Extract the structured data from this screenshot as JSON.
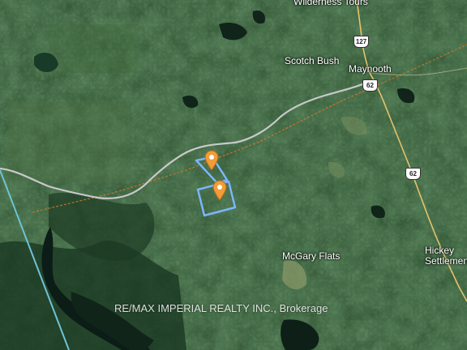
{
  "map": {
    "place_labels": {
      "wilderness_tours": "Wilderness Tours",
      "scotch_bush": "Scotch Bush",
      "maynooth": "Maynooth",
      "mcgary_flats": "McGary Flats",
      "hickey_settlement": "Hickey\nSettlement"
    },
    "route_shields": {
      "highway_127": "127",
      "highway_62_north": "62",
      "highway_62_south": "62"
    },
    "watermark": "RE/MAX IMPERIAL REALTY INC., Brokerage",
    "markers": [
      {
        "icon": "location-pin-icon",
        "color": "#f29c38"
      },
      {
        "icon": "location-pin-icon",
        "color": "#f29c38"
      }
    ],
    "colors": {
      "forest": "#2a4d2c",
      "road": "#c9c9c9",
      "highway": "#e8c36a",
      "parcel_outline": "#7ab6ff",
      "railway": "#d9772b",
      "boundary": "#6ec3d6"
    }
  }
}
